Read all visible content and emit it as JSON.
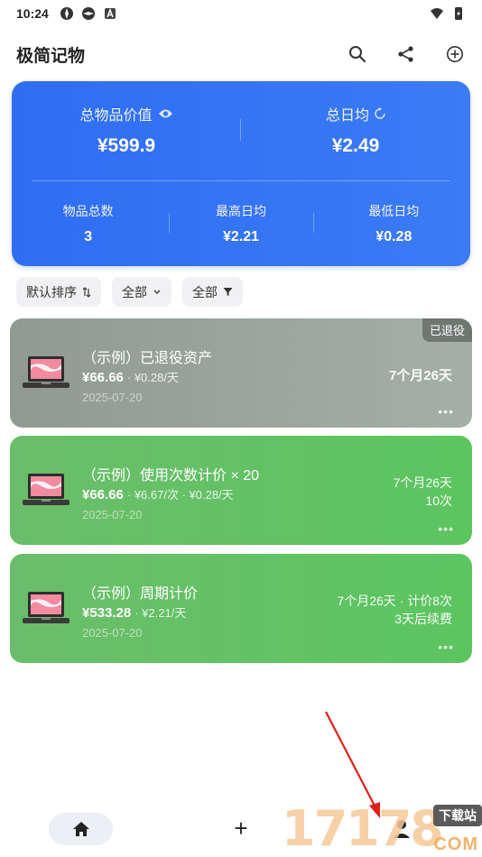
{
  "status_bar": {
    "time": "10:24"
  },
  "app": {
    "title": "极简记物"
  },
  "summary": {
    "total_value_label": "总物品价值",
    "total_value": "¥599.9",
    "daily_avg_label": "总日均",
    "daily_avg": "¥2.49",
    "item_count_label": "物品总数",
    "item_count": "3",
    "max_daily_label": "最高日均",
    "max_daily": "¥2.21",
    "min_daily_label": "最低日均",
    "min_daily": "¥0.28"
  },
  "filters": {
    "sort_label": "默认排序",
    "category_label": "全部",
    "status_label": "全部"
  },
  "items": [
    {
      "name": "（示例）已退役资产",
      "price": "¥66.66",
      "sub": "· ¥0.28/天",
      "date": "2025-07-20",
      "duration": "7个月26天",
      "badge": "已退役"
    },
    {
      "name": "（示例）使用次数计价 × 20",
      "price": "¥66.66",
      "sub": "· ¥6.67/次 · ¥0.28/天",
      "date": "2025-07-20",
      "duration": "7个月26天",
      "extra": "10次"
    },
    {
      "name": "（示例）周期计价",
      "price": "¥533.28",
      "sub": "· ¥2.21/天",
      "date": "2025-07-20",
      "duration": "7个月26天 · 计价8次",
      "extra": "3天后续费"
    }
  ],
  "more_label": "•••",
  "bottom_nav": {
    "add_symbol": "+"
  },
  "watermark": {
    "digits": "17178",
    "badge": "下载站",
    "suffix": "COM"
  },
  "colors": {
    "summary_blue": "#2f6df3",
    "card_green": "#5cc560",
    "card_retired": "#98a39b"
  }
}
